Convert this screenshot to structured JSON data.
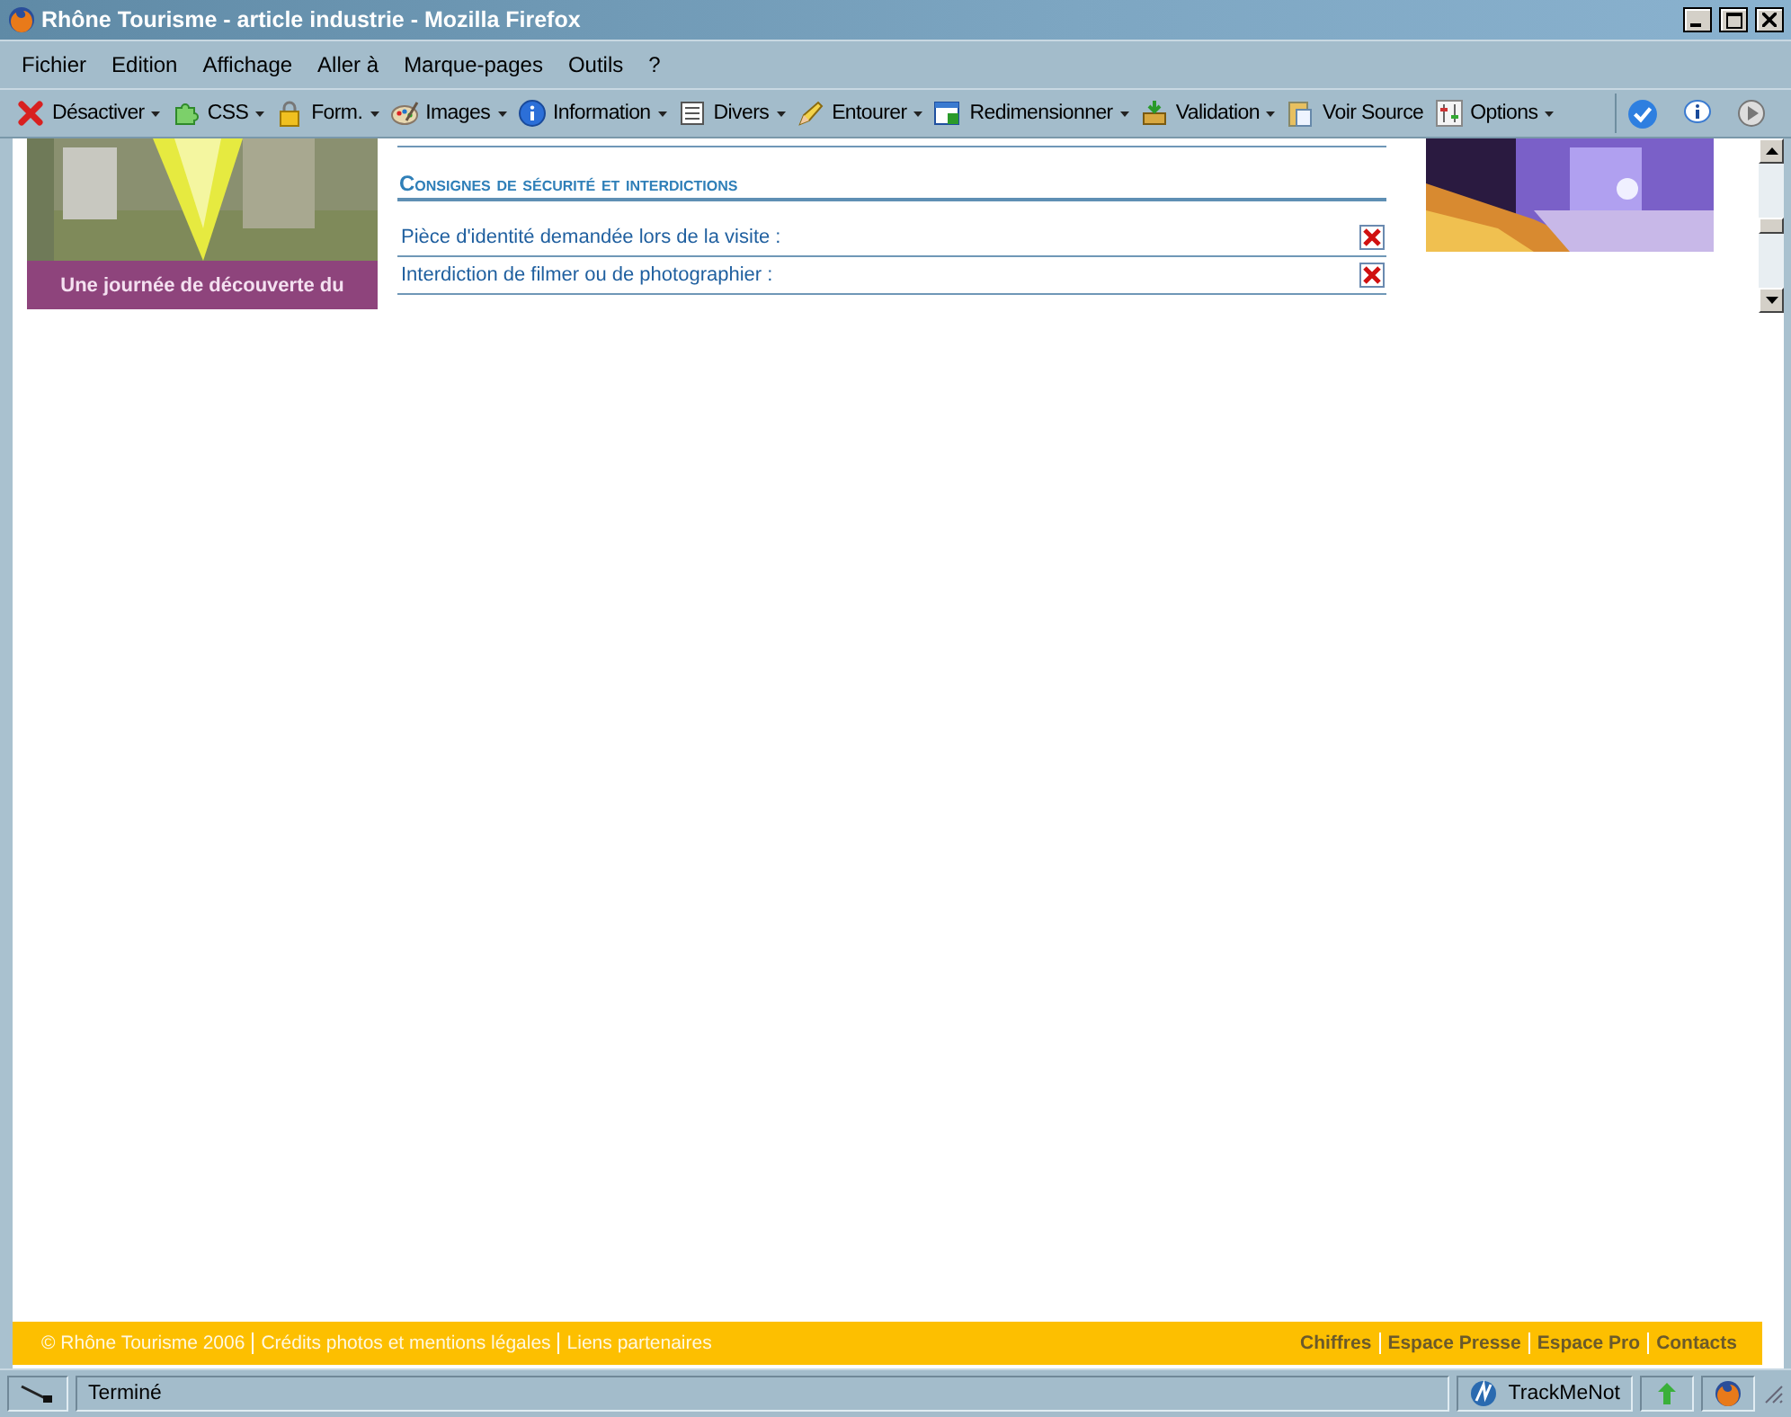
{
  "window": {
    "title": "Rhône Tourisme - article industrie - Mozilla Firefox"
  },
  "menu": [
    "Fichier",
    "Edition",
    "Affichage",
    "Aller à",
    "Marque-pages",
    "Outils",
    "?"
  ],
  "toolbar": [
    {
      "label": "Désactiver",
      "dropdown": true
    },
    {
      "label": "CSS",
      "dropdown": true
    },
    {
      "label": "Form.",
      "dropdown": true
    },
    {
      "label": "Images",
      "dropdown": true
    },
    {
      "label": "Information",
      "dropdown": true
    },
    {
      "label": "Divers",
      "dropdown": true
    },
    {
      "label": "Entourer",
      "dropdown": true
    },
    {
      "label": "Redimensionner",
      "dropdown": true
    },
    {
      "label": "Validation",
      "dropdown": true
    },
    {
      "label": "Voir Source",
      "dropdown": false
    },
    {
      "label": "Options",
      "dropdown": true
    }
  ],
  "page": {
    "left_caption": "Une journée de découverte du",
    "section_title": "Consignes de sécurité et interdictions",
    "rows": [
      {
        "label": "Pièce d'identité demandée lors de la visite :"
      },
      {
        "label": "Interdiction de filmer ou de photographier :"
      }
    ]
  },
  "footer": {
    "left_links": [
      "© Rhône Tourisme 2006",
      "Crédits photos et mentions légales",
      "Liens partenaires"
    ],
    "right_links": [
      "Chiffres",
      "Espace Presse",
      "Espace Pro",
      "Contacts"
    ]
  },
  "status_bar": {
    "text": "Terminé",
    "extension": "TrackMeNot"
  }
}
